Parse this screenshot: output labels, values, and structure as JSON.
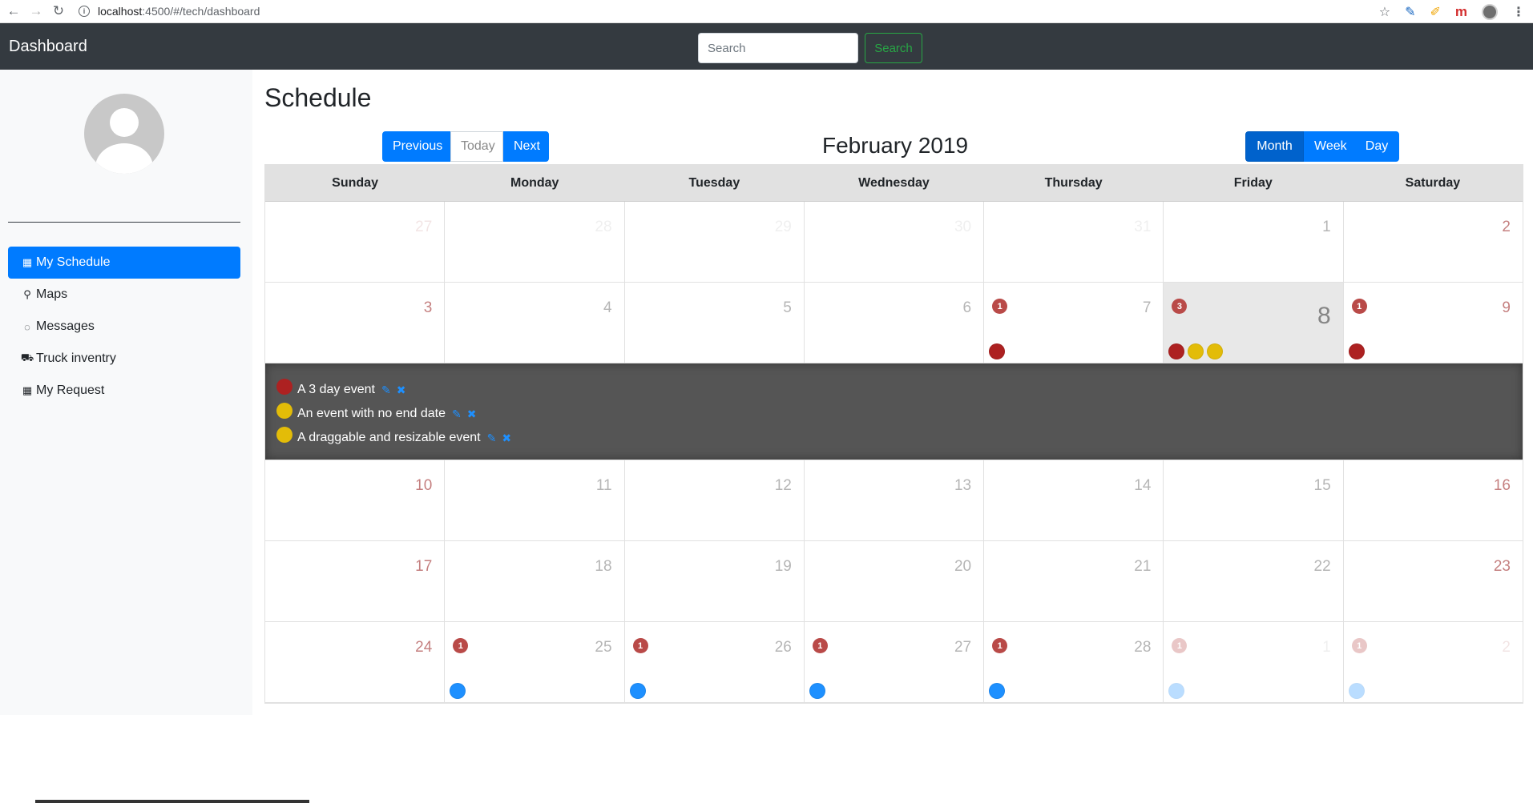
{
  "browser": {
    "url_host": "localhost",
    "url_rest": ":4500/#/tech/dashboard",
    "ext_m_label": "m"
  },
  "navbar": {
    "brand": "Dashboard",
    "search_placeholder": "Search",
    "search_button": "Search"
  },
  "sidebar": {
    "items": [
      {
        "label": "My Schedule",
        "icon": "calendar-icon",
        "glyph": "▦",
        "active": true
      },
      {
        "label": "Maps",
        "icon": "map-marker-icon",
        "glyph": "⚲",
        "active": false
      },
      {
        "label": "Messages",
        "icon": "comment-icon",
        "glyph": "◌",
        "active": false
      },
      {
        "label": "Truck inventry",
        "icon": "truck-icon",
        "glyph": "⛟",
        "active": false
      },
      {
        "label": "My Request",
        "icon": "calendar-icon",
        "glyph": "▦",
        "active": false
      }
    ]
  },
  "main": {
    "title": "Schedule",
    "month_title": "February 2019",
    "nav_buttons": {
      "previous": "Previous",
      "today": "Today",
      "next": "Next"
    },
    "view_buttons": {
      "month": "Month",
      "week": "Week",
      "day": "Day"
    }
  },
  "calendar": {
    "weekdays": [
      "Sunday",
      "Monday",
      "Tuesday",
      "Wednesday",
      "Thursday",
      "Friday",
      "Saturday"
    ],
    "colors": {
      "red": "#ad2121",
      "yellow": "#e3bc08",
      "blue": "#1e90ff"
    },
    "weeks": [
      [
        {
          "n": "27",
          "outside": true
        },
        {
          "n": "28",
          "outside": true
        },
        {
          "n": "29",
          "outside": true
        },
        {
          "n": "30",
          "outside": true
        },
        {
          "n": "31",
          "outside": true
        },
        {
          "n": "1"
        },
        {
          "n": "2"
        }
      ],
      [
        {
          "n": "3"
        },
        {
          "n": "4"
        },
        {
          "n": "5"
        },
        {
          "n": "6"
        },
        {
          "n": "7",
          "badge": "1",
          "dots": [
            "red"
          ]
        },
        {
          "n": "8",
          "today": true,
          "badge": "3",
          "dots": [
            "red",
            "yellow",
            "yellow"
          ]
        },
        {
          "n": "9",
          "badge": "1",
          "dots": [
            "red"
          ]
        }
      ],
      [
        {
          "n": "10"
        },
        {
          "n": "11"
        },
        {
          "n": "12"
        },
        {
          "n": "13"
        },
        {
          "n": "14"
        },
        {
          "n": "15"
        },
        {
          "n": "16"
        }
      ],
      [
        {
          "n": "17"
        },
        {
          "n": "18"
        },
        {
          "n": "19"
        },
        {
          "n": "20"
        },
        {
          "n": "21"
        },
        {
          "n": "22"
        },
        {
          "n": "23"
        }
      ],
      [
        {
          "n": "24"
        },
        {
          "n": "25",
          "badge": "1",
          "dots": [
            "blue"
          ]
        },
        {
          "n": "26",
          "badge": "1",
          "dots": [
            "blue"
          ]
        },
        {
          "n": "27",
          "badge": "1",
          "dots": [
            "blue"
          ]
        },
        {
          "n": "28",
          "badge": "1",
          "dots": [
            "blue"
          ]
        },
        {
          "n": "1",
          "outside": true,
          "badge": "1",
          "dots": [
            "blue"
          ]
        },
        {
          "n": "2",
          "outside": true,
          "badge": "1",
          "dots": [
            "blue"
          ]
        }
      ]
    ],
    "open_day_events": [
      {
        "title": "A 3 day event",
        "color": "red"
      },
      {
        "title": "An event with no end date",
        "color": "yellow"
      },
      {
        "title": "A draggable and resizable event",
        "color": "yellow"
      }
    ]
  }
}
